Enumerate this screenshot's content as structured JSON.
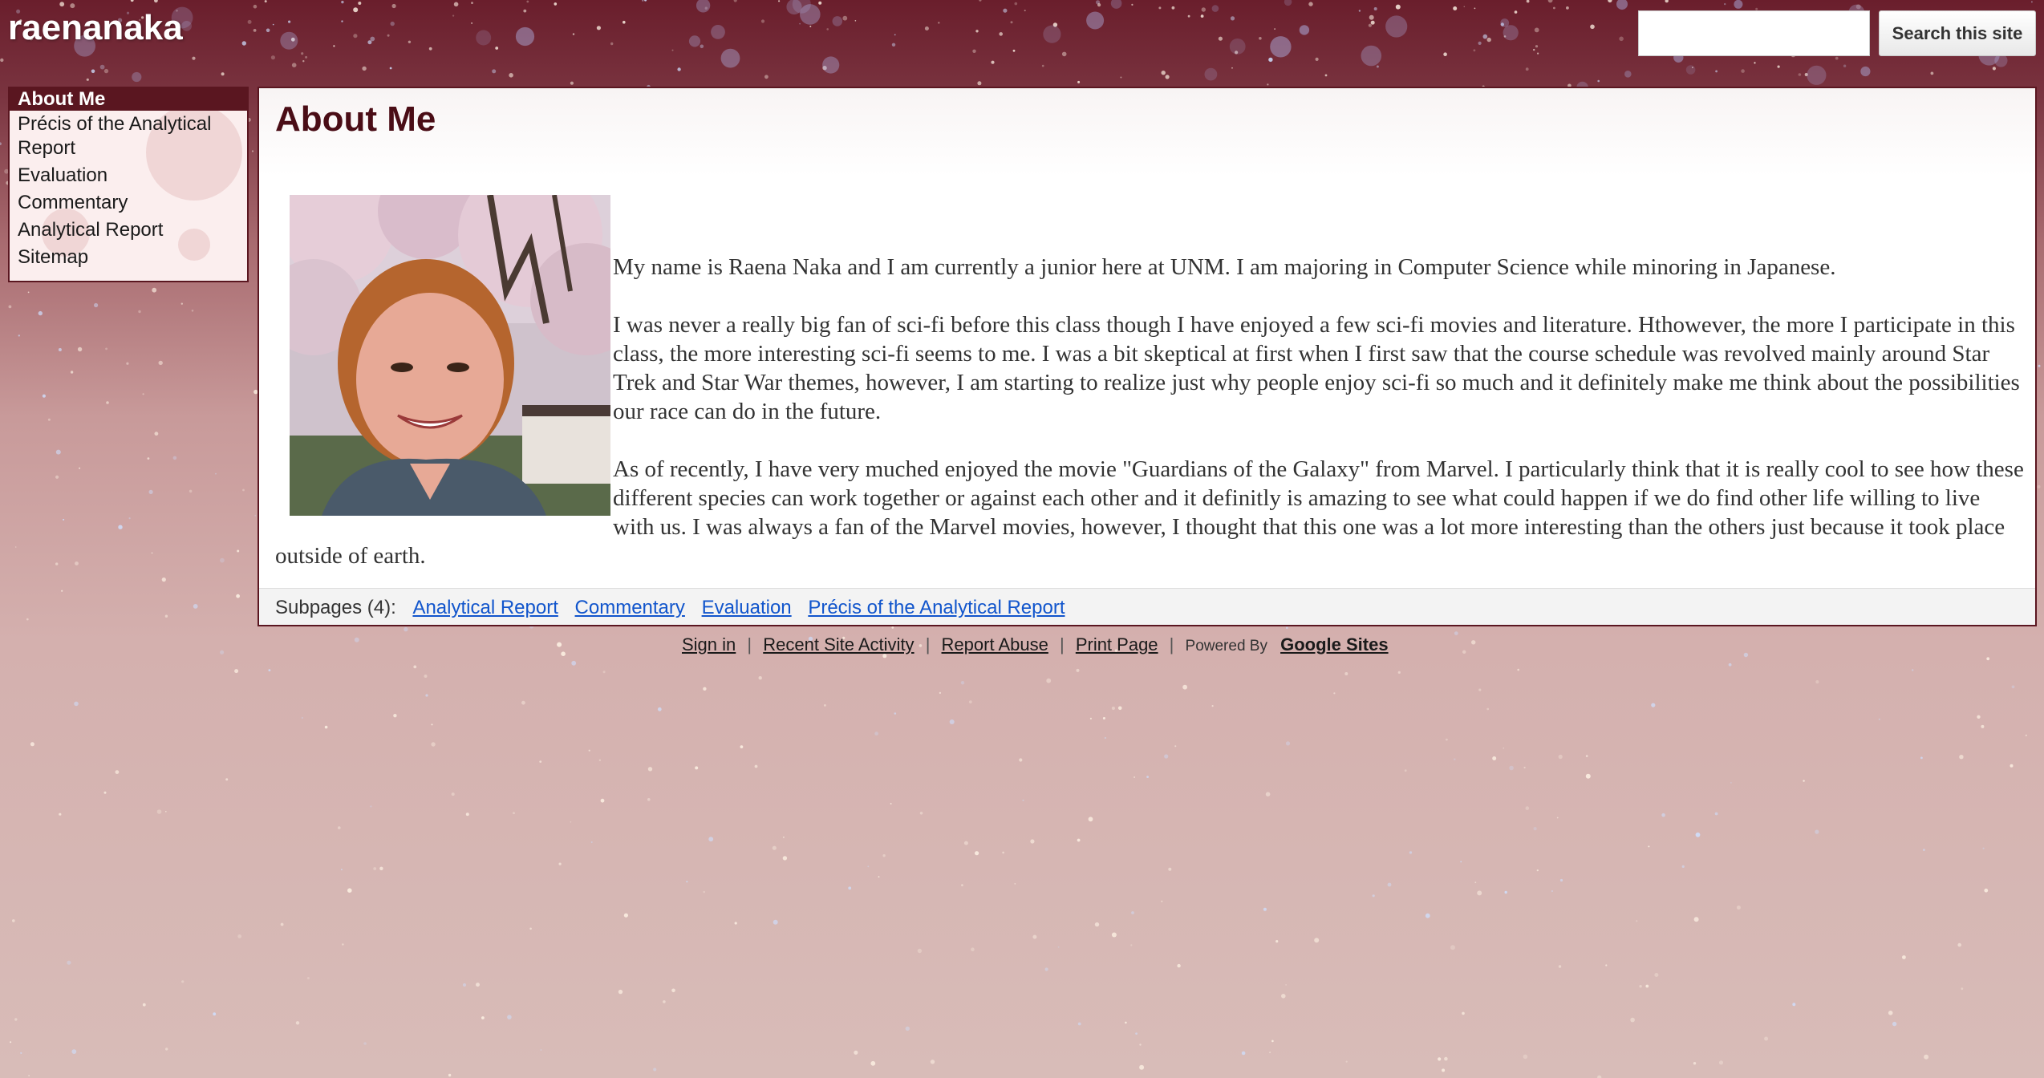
{
  "site": {
    "title": "raenanaka"
  },
  "search": {
    "placeholder": "",
    "button_label": "Search this site"
  },
  "sidebar": {
    "items": [
      {
        "label": "About Me",
        "active": true
      },
      {
        "label": "Précis of the Analytical Report"
      },
      {
        "label": "Evaluation"
      },
      {
        "label": "Commentary"
      },
      {
        "label": "Analytical Report"
      },
      {
        "label": "Sitemap"
      }
    ]
  },
  "page": {
    "title": "About Me",
    "paragraphs": [
      "My name is Raena Naka and I am currently a junior here at UNM. I am majoring in Computer Science while minoring in Japanese.",
      "I was never a really big fan of sci-fi before this class though I have enjoyed a few sci-fi movies and literature. Hthowever, the more I participate in this class, the more interesting sci-fi seems to me. I was a bit skeptical at first when I first saw that the course schedule was revolved mainly around Star Trek and Star War themes, however, I am starting to realize just why people enjoy sci-fi so much and it definitely make me think about the possibilities our race can do in the future.",
      "As of recently, I have very muched enjoyed the movie \"Guardians of the Galaxy\" from Marvel. I particularly think that it is really cool to see how these different species can work together or against each other and it definitly is amazing to see what could happen if we do find other life willing to live with us. I was always a fan of the Marvel movies, however, I thought that this one was a lot more interesting than the others just because it took place outside of earth."
    ]
  },
  "subpages": {
    "label": "Subpages (4):",
    "links": [
      "Analytical Report",
      "Commentary",
      "Evaluation",
      "Précis of the Analytical Report"
    ]
  },
  "footer": {
    "sign_in": "Sign in",
    "recent_activity": "Recent Site Activity",
    "report_abuse": "Report Abuse",
    "print_page": "Print Page",
    "separator": "|",
    "powered_by": "Powered By",
    "google_sites": "Google Sites"
  },
  "colors": {
    "accent": "#5a1620",
    "title": "#4a0d16",
    "link": "#1155cc"
  }
}
